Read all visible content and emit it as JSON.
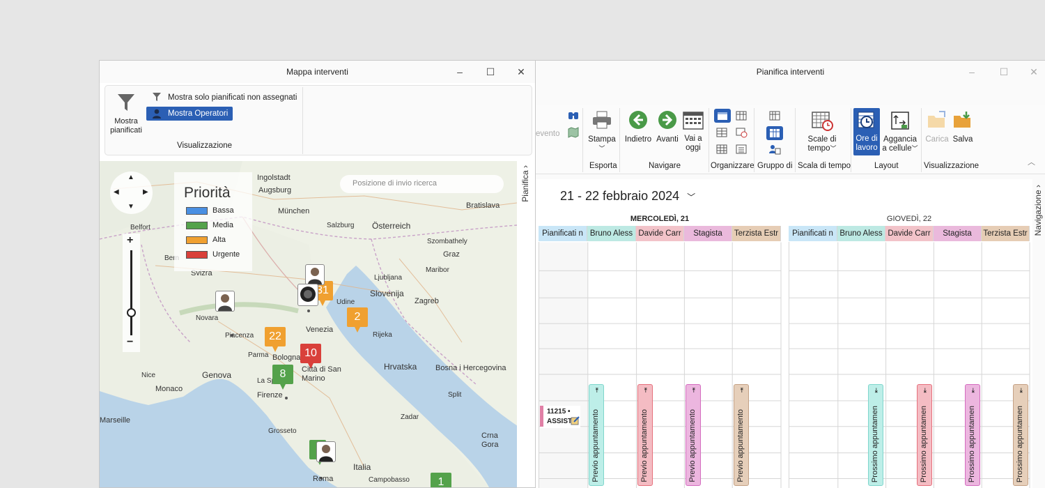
{
  "map_window": {
    "title": "Mappa interventi",
    "ribbon": {
      "filter_label_1": "Mostra",
      "filter_label_2": "pianificati",
      "show_unassigned": "Mostra solo pianificati non assegnati",
      "show_operators": "Mostra Operatori",
      "group_label": "Visualizzazione"
    },
    "side_tab": "Pianifica",
    "search_placeholder": "Posizione di invio ricerca",
    "legend": {
      "title": "Priorità",
      "items": [
        {
          "label": "Bassa",
          "color": "#4a90e2"
        },
        {
          "label": "Media",
          "color": "#54a24b"
        },
        {
          "label": "Alta",
          "color": "#f0a030"
        },
        {
          "label": "Urgente",
          "color": "#d9403a"
        }
      ]
    },
    "zoom": {
      "plus": "+",
      "minus": "−"
    },
    "places": [
      {
        "name": "Ingolstadt"
      },
      {
        "name": "Augsburg"
      },
      {
        "name": "München"
      },
      {
        "name": "Salzburg"
      },
      {
        "name": "Österreich"
      },
      {
        "name": "Bratislava"
      },
      {
        "name": "Graz"
      },
      {
        "name": "Maribor"
      },
      {
        "name": "Slovenija"
      },
      {
        "name": "Zagreb"
      },
      {
        "name": "Ljubljana"
      },
      {
        "name": "Svizra"
      },
      {
        "name": "Belfort"
      },
      {
        "name": "Bern"
      },
      {
        "name": "Novara"
      },
      {
        "name": "Piacenza"
      },
      {
        "name": "Parma"
      },
      {
        "name": "Bologna"
      },
      {
        "name": "Venezia"
      },
      {
        "name": "Udine"
      },
      {
        "name": "Rijeka"
      },
      {
        "name": "Hrvatska"
      },
      {
        "name": "Città di San Marino"
      },
      {
        "name": "Genova"
      },
      {
        "name": "Monaco"
      },
      {
        "name": "La Spezia"
      },
      {
        "name": "Firenze"
      },
      {
        "name": "Bosna i Hercegovina"
      },
      {
        "name": "Crna Gora"
      },
      {
        "name": "Italia"
      },
      {
        "name": "Roma"
      },
      {
        "name": "Campobasso"
      },
      {
        "name": "Grosseto"
      },
      {
        "name": "Nice"
      },
      {
        "name": "Marseille"
      },
      {
        "name": "Szombathely"
      },
      {
        "name": "Zadar"
      },
      {
        "name": "Split"
      }
    ],
    "pins": [
      {
        "label": "22",
        "color": "#f0a030"
      },
      {
        "label": "10",
        "color": "#d9403a"
      },
      {
        "label": "8",
        "color": "#54a24b"
      },
      {
        "label": "2",
        "color": "#f0a030"
      },
      {
        "label": "31",
        "color": "#f0a030"
      },
      {
        "label": "1",
        "color": "#54a24b"
      }
    ]
  },
  "plan_window": {
    "title": "Pianifica interventi",
    "ribbon": {
      "cut_label": "evento",
      "buttons": {
        "print": "Stampa",
        "back": "Indietro",
        "forward": "Avanti",
        "today_1": "Vai a",
        "today_2": "oggi",
        "timescale_1": "Scale di",
        "timescale_2": "tempo",
        "workhours_1": "Ore di",
        "workhours_2": "lavoro",
        "snap_1": "Aggancia",
        "snap_2": "a cellule",
        "load": "Carica",
        "save": "Salva"
      },
      "groups": {
        "export": "Esporta",
        "navigate": "Navigare",
        "arrange": "Organizzare",
        "group_by": "Gruppo di",
        "time_scale": "Scala di tempo",
        "layout": "Layout",
        "view": "Visualizzazione"
      }
    },
    "side_tab": "Navigazione",
    "date_range": "21 - 22 febbraio 2024",
    "days": [
      {
        "header": "MERCOLEDÌ, 21",
        "columns": [
          "Pianificati n",
          "Bruno Aless",
          "Davide Carr",
          "Stagista",
          "Terzista Estr"
        ],
        "appointment_label": "Previo appuntamento"
      },
      {
        "header": "GIOVEDÌ, 22",
        "columns": [
          "Pianificati n",
          "Bruno Aless",
          "Davide Carr",
          "Stagista",
          "Terzista Estr"
        ],
        "appointment_label": "Prossimo appuntamen"
      }
    ],
    "column_colors": [
      "#c9e6f7",
      "#bde9e3",
      "#f2c3c9",
      "#eab9dc",
      "#e6cdb5"
    ],
    "appt_colors": [
      "#7fd6cc",
      "#e6707c",
      "#d46cbf",
      "#c4a184"
    ],
    "event": {
      "line1": "11215 •",
      "line2": "ASSISTE"
    }
  }
}
